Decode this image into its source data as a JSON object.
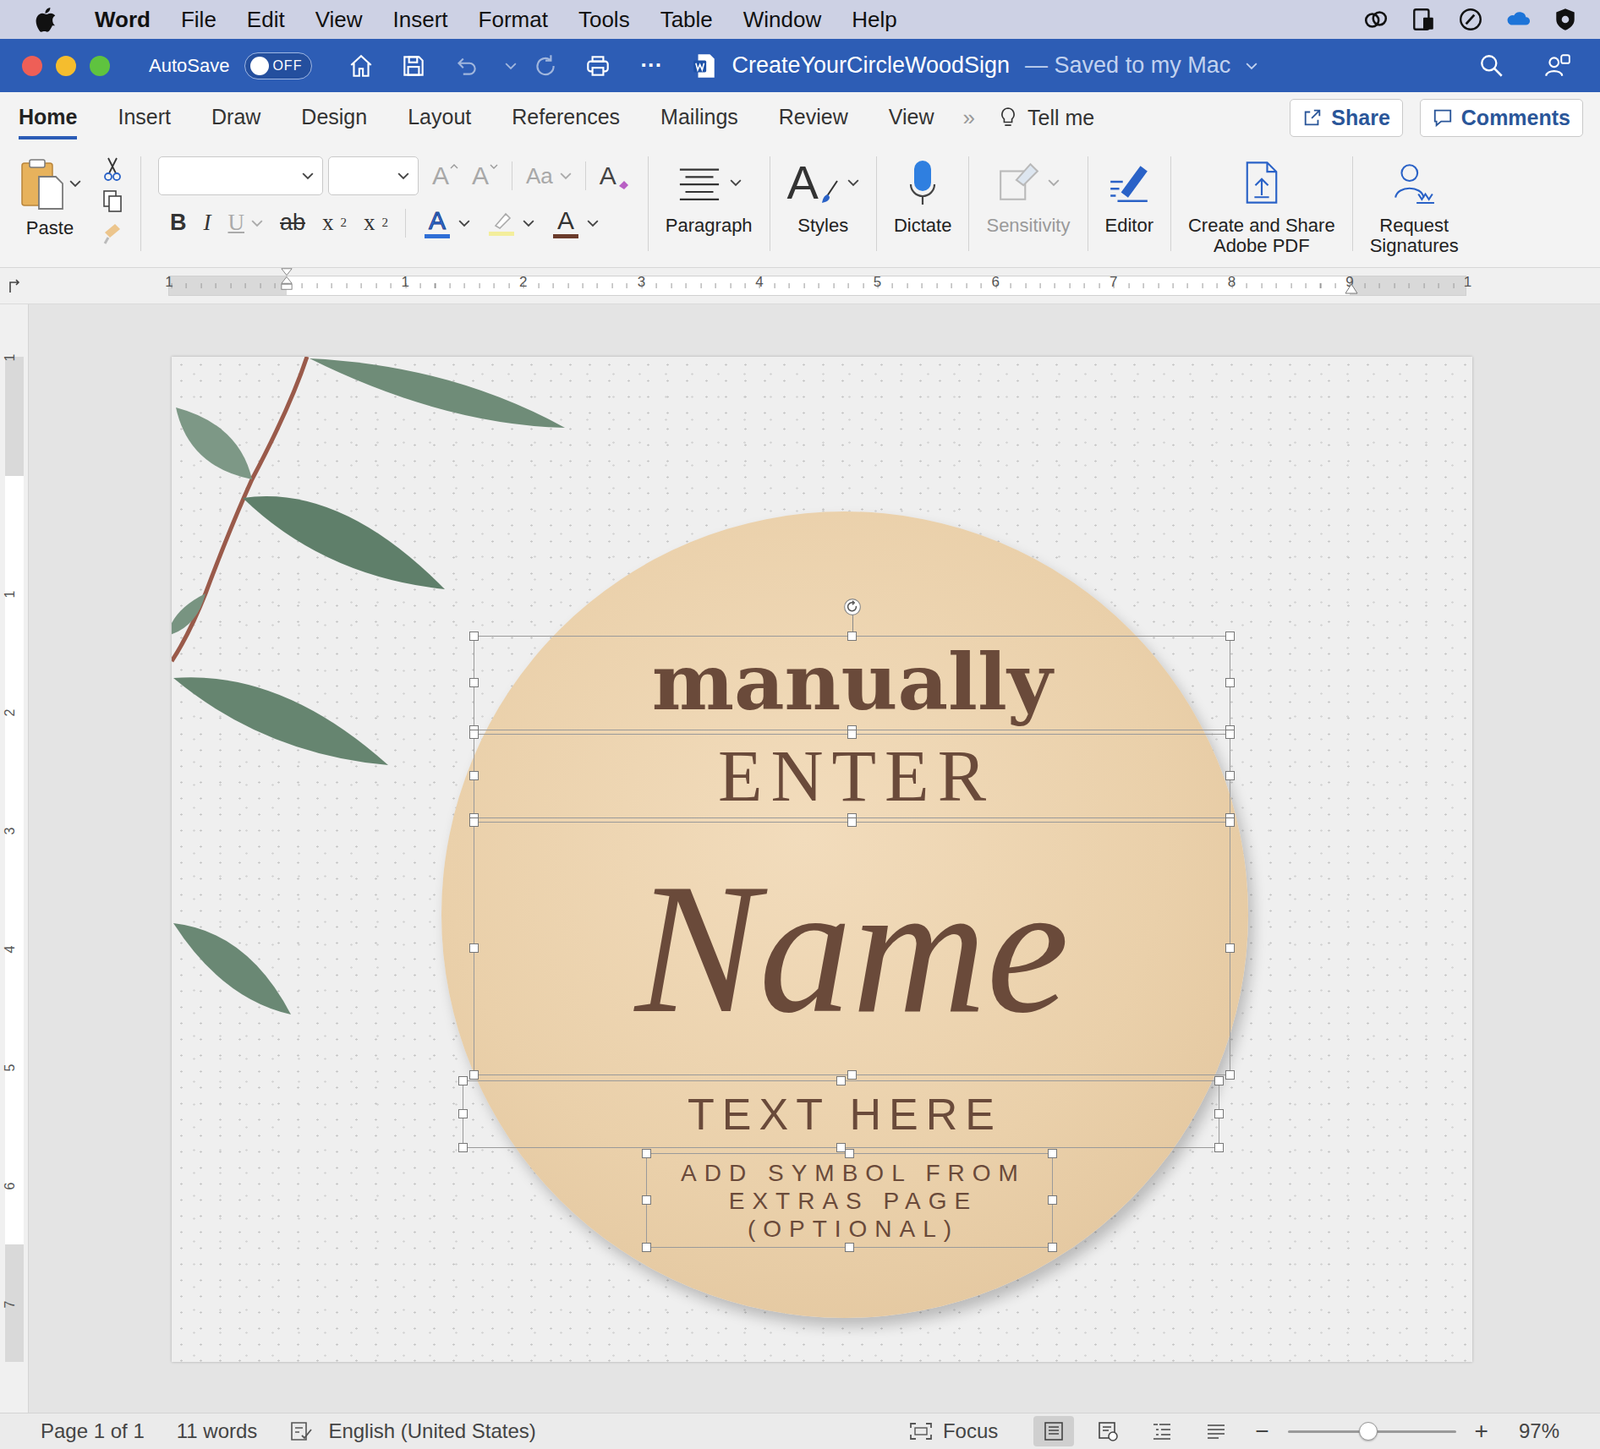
{
  "menu_bar": {
    "app": "Word",
    "items": [
      "File",
      "Edit",
      "View",
      "Insert",
      "Format",
      "Tools",
      "Table",
      "Window",
      "Help"
    ]
  },
  "title_bar": {
    "autosave_label": "AutoSave",
    "autosave": {
      "on": false,
      "label": "OFF"
    },
    "more": "···",
    "document": "CreateYourCircleWoodSign",
    "save_status": "— Saved to my Mac"
  },
  "tabs": [
    {
      "label": "Home",
      "selected": true
    },
    {
      "label": "Insert",
      "selected": false
    },
    {
      "label": "Draw",
      "selected": false
    },
    {
      "label": "Design",
      "selected": false
    },
    {
      "label": "Layout",
      "selected": false
    },
    {
      "label": "References",
      "selected": false
    },
    {
      "label": "Mailings",
      "selected": false
    },
    {
      "label": "Review",
      "selected": false
    },
    {
      "label": "View",
      "selected": false
    }
  ],
  "tabs_overflow": "»",
  "tell_me": "Tell me",
  "share": "Share",
  "comments": "Comments",
  "ribbon": {
    "paste": "Paste",
    "font_name": "",
    "font_size": "",
    "grow_font": "A",
    "shrink_font": "A",
    "change_case": "Aa",
    "clear_formatting": "A",
    "format_buttons": [
      {
        "glyph": "B",
        "kind": "bold",
        "disabled": false,
        "script": ""
      },
      {
        "glyph": "I",
        "kind": "italic",
        "disabled": false,
        "script": ""
      },
      {
        "glyph": "U",
        "kind": "underline",
        "disabled": true,
        "script": ""
      },
      {
        "glyph": "ab",
        "kind": "strike",
        "disabled": false,
        "script": ""
      },
      {
        "glyph": "x",
        "kind": "subscript",
        "disabled": false,
        "script": "2"
      },
      {
        "glyph": "x",
        "kind": "superscript",
        "disabled": false,
        "script": "2"
      }
    ],
    "color_buttons": [
      {
        "glyph": "A",
        "kind": "text-effects",
        "color": "#2f6fd6"
      },
      {
        "glyph": "",
        "kind": "highlight",
        "color": "#f3ee9c"
      },
      {
        "glyph": "A",
        "kind": "font-color",
        "color": "#6b3b2b"
      }
    ],
    "big_buttons": [
      {
        "lines": [
          "Paragraph"
        ],
        "kind": "paragraph",
        "disabled": false,
        "dropdown": true,
        "glyph": ""
      },
      {
        "lines": [
          "Styles"
        ],
        "kind": "styles",
        "disabled": false,
        "dropdown": true,
        "glyph": "A"
      },
      {
        "lines": [
          "Dictate"
        ],
        "kind": "dictate",
        "disabled": false,
        "dropdown": false,
        "glyph": ""
      },
      {
        "lines": [
          "Sensitivity"
        ],
        "kind": "sensitivity",
        "disabled": true,
        "dropdown": true,
        "glyph": ""
      },
      {
        "lines": [
          "Editor"
        ],
        "kind": "editor",
        "disabled": false,
        "dropdown": false,
        "glyph": ""
      },
      {
        "lines": [
          "Create and Share",
          "Adobe PDF"
        ],
        "kind": "adobe",
        "disabled": false,
        "dropdown": false,
        "glyph": ""
      },
      {
        "lines": [
          "Request",
          "Signatures"
        ],
        "kind": "signatures",
        "disabled": false,
        "dropdown": false,
        "glyph": ""
      }
    ]
  },
  "ruler": {
    "h_numbers": [
      "1",
      "1",
      "2",
      "3",
      "4",
      "5",
      "6",
      "7",
      "8",
      "9",
      "1"
    ],
    "v_numbers": [
      "1",
      "1",
      "2",
      "3",
      "4",
      "5",
      "6",
      "7"
    ]
  },
  "document": {
    "textboxes": [
      {
        "lines": [
          "manually"
        ],
        "kind": "serif-bold",
        "selected": true
      },
      {
        "lines": [
          "ENTER"
        ],
        "kind": "serif-caps",
        "selected": true
      },
      {
        "lines": [
          "Name"
        ],
        "kind": "script",
        "selected": true
      },
      {
        "lines": [
          "TEXT HERE"
        ],
        "kind": "sans-spaced",
        "selected": true
      },
      {
        "lines": [
          "ADD SYMBOL FROM",
          "EXTRAS PAGE",
          "(OPTIONAL)"
        ],
        "kind": "sans-small",
        "selected": true
      }
    ]
  },
  "status_bar": {
    "page": "Page 1 of 1",
    "words": "11 words",
    "language": "English (United States)",
    "focus": "Focus",
    "views": [
      {
        "kind": "print",
        "selected": true
      },
      {
        "kind": "web",
        "selected": false
      },
      {
        "kind": "outline",
        "selected": false
      },
      {
        "kind": "draft",
        "selected": false
      }
    ],
    "zoom": {
      "minus": "−",
      "plus": "+",
      "level": 0.48,
      "reading": "97%"
    }
  }
}
